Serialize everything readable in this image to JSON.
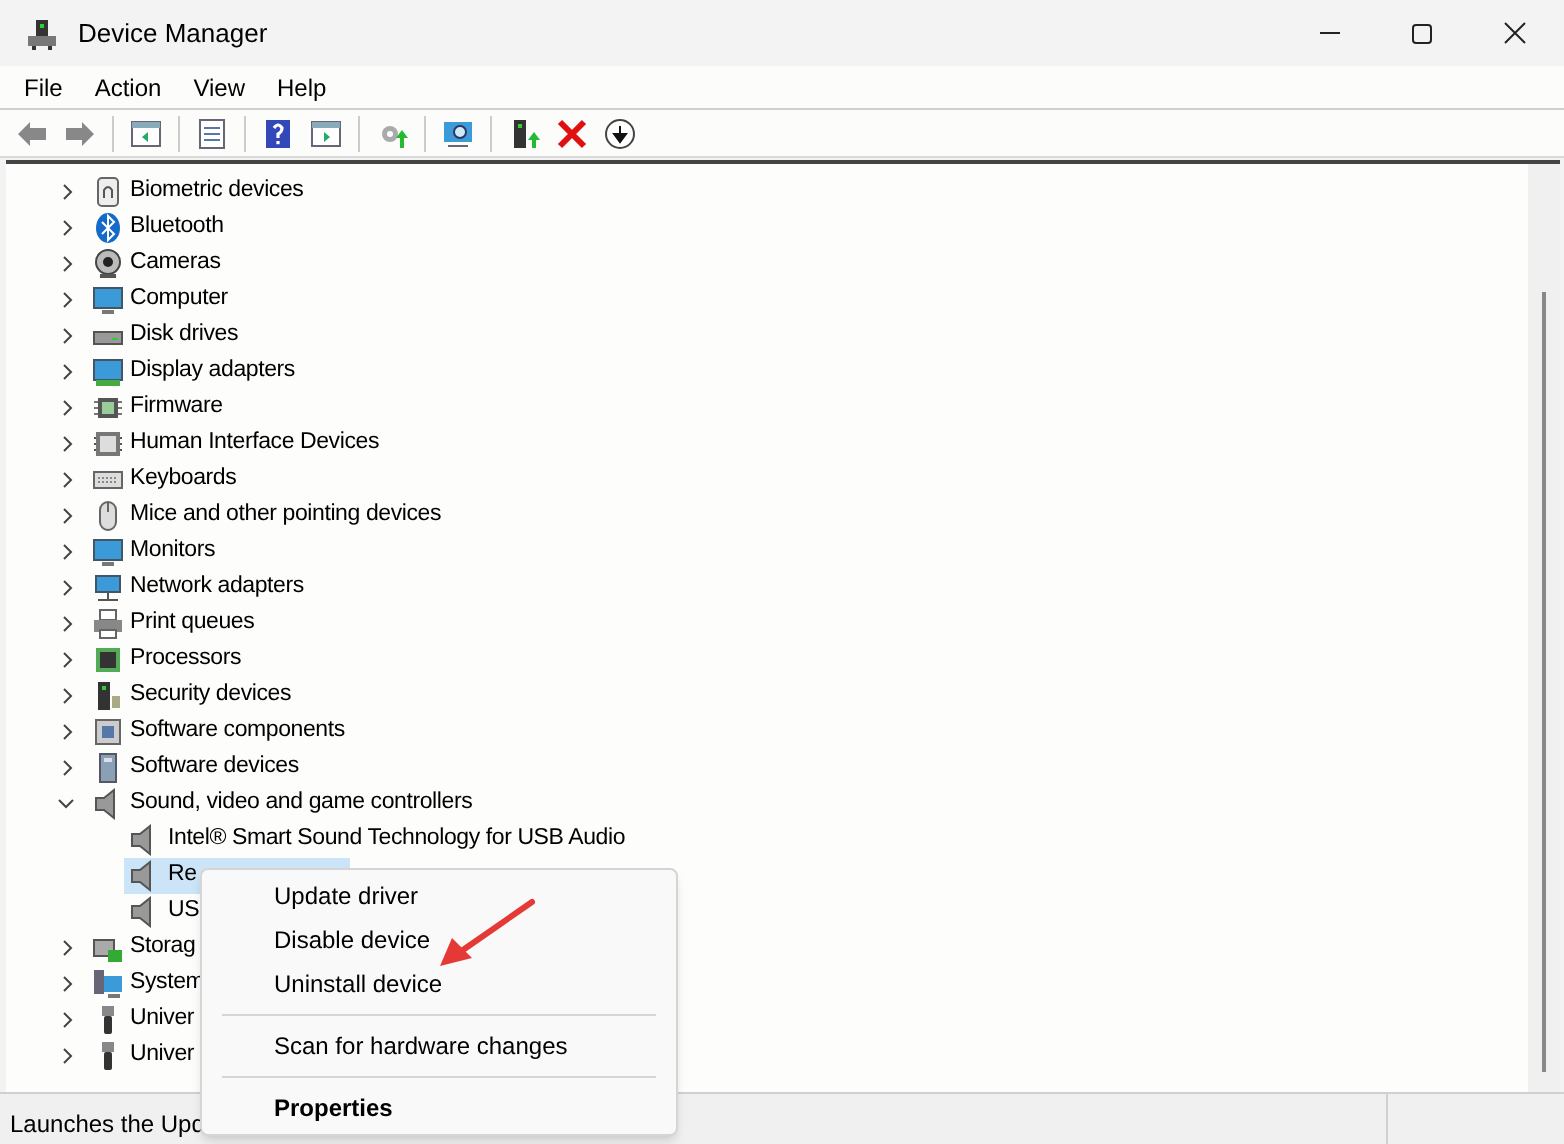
{
  "window": {
    "title": "Device Manager"
  },
  "menu": [
    "File",
    "Action",
    "View",
    "Help"
  ],
  "tree": [
    {
      "label": "Biometric devices",
      "expanded": false
    },
    {
      "label": "Bluetooth",
      "expanded": false
    },
    {
      "label": "Cameras",
      "expanded": false
    },
    {
      "label": "Computer",
      "expanded": false
    },
    {
      "label": "Disk drives",
      "expanded": false
    },
    {
      "label": "Display adapters",
      "expanded": false
    },
    {
      "label": "Firmware",
      "expanded": false
    },
    {
      "label": "Human Interface Devices",
      "expanded": false
    },
    {
      "label": "Keyboards",
      "expanded": false
    },
    {
      "label": "Mice and other pointing devices",
      "expanded": false
    },
    {
      "label": "Monitors",
      "expanded": false
    },
    {
      "label": "Network adapters",
      "expanded": false
    },
    {
      "label": "Print queues",
      "expanded": false
    },
    {
      "label": "Processors",
      "expanded": false
    },
    {
      "label": "Security devices",
      "expanded": false
    },
    {
      "label": "Software components",
      "expanded": false
    },
    {
      "label": "Software devices",
      "expanded": false
    },
    {
      "label": "Sound, video and game controllers",
      "expanded": true,
      "children": [
        {
          "label": "Intel® Smart Sound Technology for USB Audio",
          "selected": false
        },
        {
          "label": "Re",
          "selected": true
        },
        {
          "label": "US",
          "selected": false
        }
      ]
    },
    {
      "label": "Storag",
      "expanded": false
    },
    {
      "label": "System",
      "expanded": false
    },
    {
      "label": "Univer",
      "expanded": false
    },
    {
      "label": "Univer",
      "expanded": false
    }
  ],
  "context_menu": [
    {
      "kind": "item",
      "label": "Update driver"
    },
    {
      "kind": "item",
      "label": "Disable device"
    },
    {
      "kind": "item",
      "label": "Uninstall device"
    },
    {
      "kind": "separator"
    },
    {
      "kind": "item",
      "label": "Scan for hardware changes"
    },
    {
      "kind": "separator"
    },
    {
      "kind": "default",
      "label": "Properties"
    }
  ],
  "status_bar": "Launches the Upd"
}
